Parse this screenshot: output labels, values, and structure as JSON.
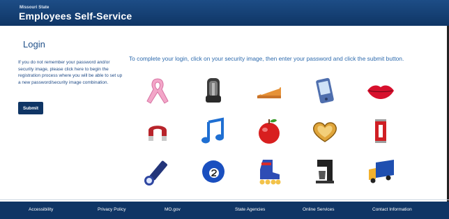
{
  "header": {
    "small_title": "Missouri State",
    "title": "Employees Self-Service"
  },
  "login": {
    "title": "Login",
    "help_prefix": "If you do not remember your password and/or security image, please ",
    "help_link": "click here",
    "help_suffix": " to begin the registration process where you will be able to set up a new password/security image combination.",
    "submit_label": "Submit"
  },
  "instructions": "To complete your login, click on your security image, then enter your password and click the submit button.",
  "security_images": [
    "awareness-ribbon",
    "car-seat",
    "pie-slice",
    "pda-device",
    "lips",
    "horseshoe-magnet",
    "music-note",
    "apple",
    "heart",
    "cola-can",
    "flashlight",
    "billiard-ball-2",
    "roller-skate",
    "coffee-maker",
    "delivery-truck"
  ],
  "footer": {
    "links": [
      "Accessibility",
      "Privacy Policy",
      "MO.gov",
      "State Agencies",
      "Online Services",
      "Contact Information"
    ]
  }
}
